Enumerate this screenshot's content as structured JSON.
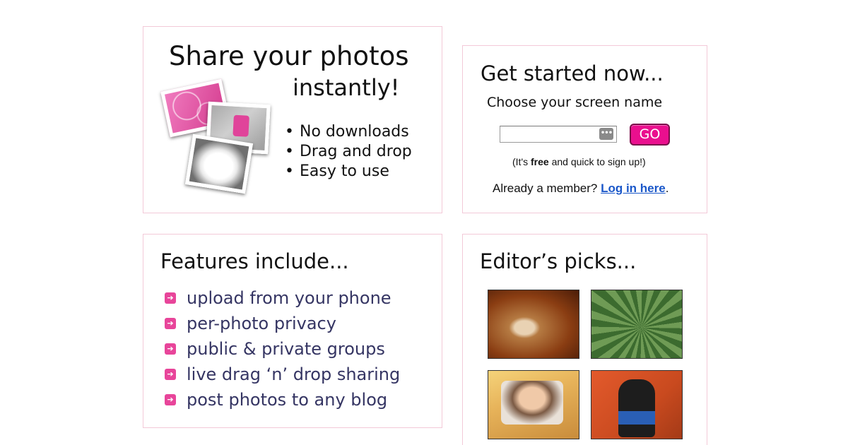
{
  "share": {
    "title_line1": "Share your photos",
    "title_line2": "instantly!",
    "bullets": [
      "No downloads",
      "Drag and drop",
      "Easy to use"
    ]
  },
  "signup": {
    "title": "Get started now...",
    "subtitle": "Choose your screen name",
    "screen_name_value": "",
    "go_label": "GO",
    "free_prefix": "(It's ",
    "free_bold": "free",
    "free_suffix": " and quick to sign up!)",
    "member_text": "Already a member? ",
    "login_link": "Log in here",
    "member_end": "."
  },
  "features": {
    "title": "Features include...",
    "items": [
      "upload from your phone",
      "per-photo privacy",
      "public & private groups",
      "live drag ‘n’ drop sharing",
      "post photos to any blog"
    ]
  },
  "picks": {
    "title": "Editor’s picks..."
  },
  "colors": {
    "accent": "#ea0f8e",
    "panel_border": "#f3c9d8",
    "feature_text": "#353563",
    "link": "#1a57c9"
  }
}
